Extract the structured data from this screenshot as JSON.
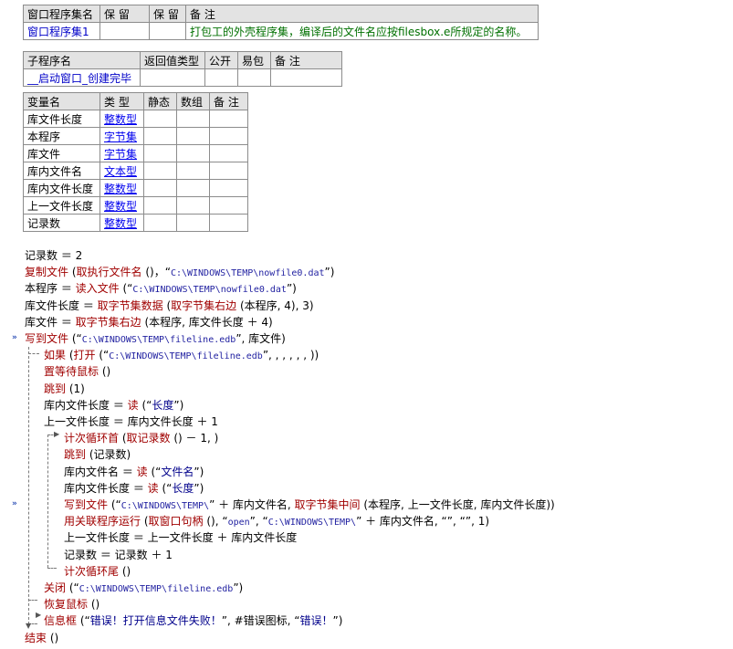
{
  "assembly_table": {
    "headers": [
      "窗口程序集名",
      "保 留",
      "保 留",
      "备 注"
    ],
    "row": [
      "窗口程序集1",
      "",
      "",
      "打包工的外壳程序集，编译后的文件名应按filesbox.e所规定的名称。"
    ]
  },
  "sub_table": {
    "headers": [
      "子程序名",
      "返回值类型",
      "公开",
      "易包",
      "备 注"
    ],
    "row": [
      "__启动窗口_创建完毕",
      "",
      "",
      "",
      ""
    ]
  },
  "var_table": {
    "headers": [
      "变量名",
      "类 型",
      "静态",
      "数组",
      "备 注"
    ],
    "rows": [
      {
        "name": "库文件长度",
        "type": "整数型"
      },
      {
        "name": "本程序",
        "type": "字节集"
      },
      {
        "name": "库文件",
        "type": "字节集"
      },
      {
        "name": "库内文件名",
        "type": "文本型"
      },
      {
        "name": "库内文件长度",
        "type": "整数型"
      },
      {
        "name": "上一文件长度",
        "type": "整数型"
      },
      {
        "name": "记录数",
        "type": "整数型"
      }
    ]
  },
  "code_lines": [
    {
      "indent": 0,
      "text": "记录数 ＝ 2"
    },
    {
      "indent": 0,
      "text": "复制文件 (取执行文件名 ()，“C:\\WINDOWS\\TEMP\\nowfile0.dat”)"
    },
    {
      "indent": 0,
      "text": "本程序 ＝ 读入文件 (“C:\\WINDOWS\\TEMP\\nowfile0.dat”)"
    },
    {
      "indent": 0,
      "text": "库文件长度 ＝ 取字节集数据 (取字节集右边 (本程序, 4), 3)"
    },
    {
      "indent": 0,
      "text": "库文件 ＝ 取字节集右边 (本程序, 库文件长度 ＋ 4)"
    },
    {
      "indent": 0,
      "text": "写到文件 (“C:\\WINDOWS\\TEMP\\fileline.edb”, 库文件)"
    },
    {
      "indent": 1,
      "text": "如果 (打开 (“C:\\WINDOWS\\TEMP\\fileline.edb”, , , , , , ))"
    },
    {
      "indent": 1,
      "text": "置等待鼠标 ()"
    },
    {
      "indent": 1,
      "text": "跳到 (1)"
    },
    {
      "indent": 1,
      "text": "库内文件长度 ＝ 读 (“长度”)"
    },
    {
      "indent": 1,
      "text": "上一文件长度 ＝ 库内文件长度 ＋ 1"
    },
    {
      "indent": 2,
      "text": "计次循环首 (取记录数 () － 1, )"
    },
    {
      "indent": 2,
      "text": "跳到 (记录数)"
    },
    {
      "indent": 2,
      "text": "库内文件名 ＝ 读 (“文件名”)"
    },
    {
      "indent": 2,
      "text": "库内文件长度 ＝ 读 (“长度”)"
    },
    {
      "indent": 2,
      "text": "写到文件 (“C:\\WINDOWS\\TEMP\\” ＋ 库内文件名, 取字节集中间 (本程序, 上一文件长度, 库内文件长度))"
    },
    {
      "indent": 2,
      "text": "用关联程序运行 (取窗口句柄 (), “open”, “C:\\WINDOWS\\TEMP\\” ＋ 库内文件名, “”, “”, 1)"
    },
    {
      "indent": 2,
      "text": "上一文件长度 ＝ 上一文件长度 ＋ 库内文件长度"
    },
    {
      "indent": 2,
      "text": "记录数 ＝ 记录数 ＋ 1"
    },
    {
      "indent": 2,
      "text": "计次循环尾 ()"
    },
    {
      "indent": 1,
      "text": "关闭 (“C:\\WINDOWS\\TEMP\\fileline.edb”)"
    },
    {
      "indent": 1,
      "text": "恢复鼠标 ()"
    },
    {
      "indent": 1,
      "text": "信息框 (“错误！打开信息文件失败！”, #错误图标, “错误！”)"
    },
    {
      "indent": 0,
      "text": "结束 ()"
    }
  ],
  "breakpoint_glyph": "»",
  "breakpoint_lines": [
    5,
    15
  ]
}
